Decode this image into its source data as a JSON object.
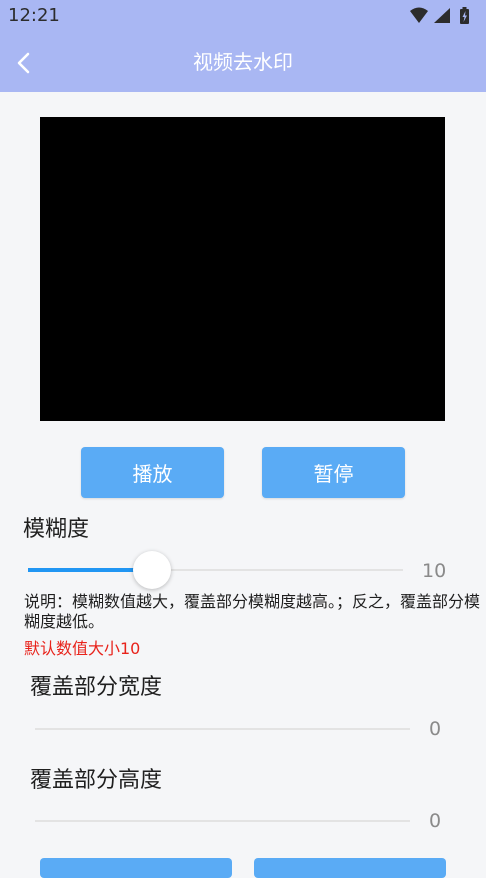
{
  "status_bar": {
    "time": "12:21",
    "icons": [
      "wifi-icon",
      "signal-icon",
      "battery-charging-icon"
    ]
  },
  "app_bar": {
    "title": "视频去水印",
    "back_icon": "chevron-left-icon",
    "background": "#a9b7f3"
  },
  "controls": {
    "play_label": "播放",
    "pause_label": "暂停",
    "button_color": "#5aabf5"
  },
  "blur": {
    "label": "模糊度",
    "value": "10",
    "level_fraction": 0.33,
    "description": "说明：模糊数值越大，覆盖部分模糊度越高。；反之，覆盖部分模糊度越低。",
    "default_note": "默认数值大小10",
    "note_color": "#e8231b"
  },
  "cover_width": {
    "label": "覆盖部分宽度",
    "value": "0",
    "level_fraction": 0
  },
  "cover_height": {
    "label": "覆盖部分高度",
    "value": "0",
    "level_fraction": 0
  },
  "accent": "#2196f3"
}
